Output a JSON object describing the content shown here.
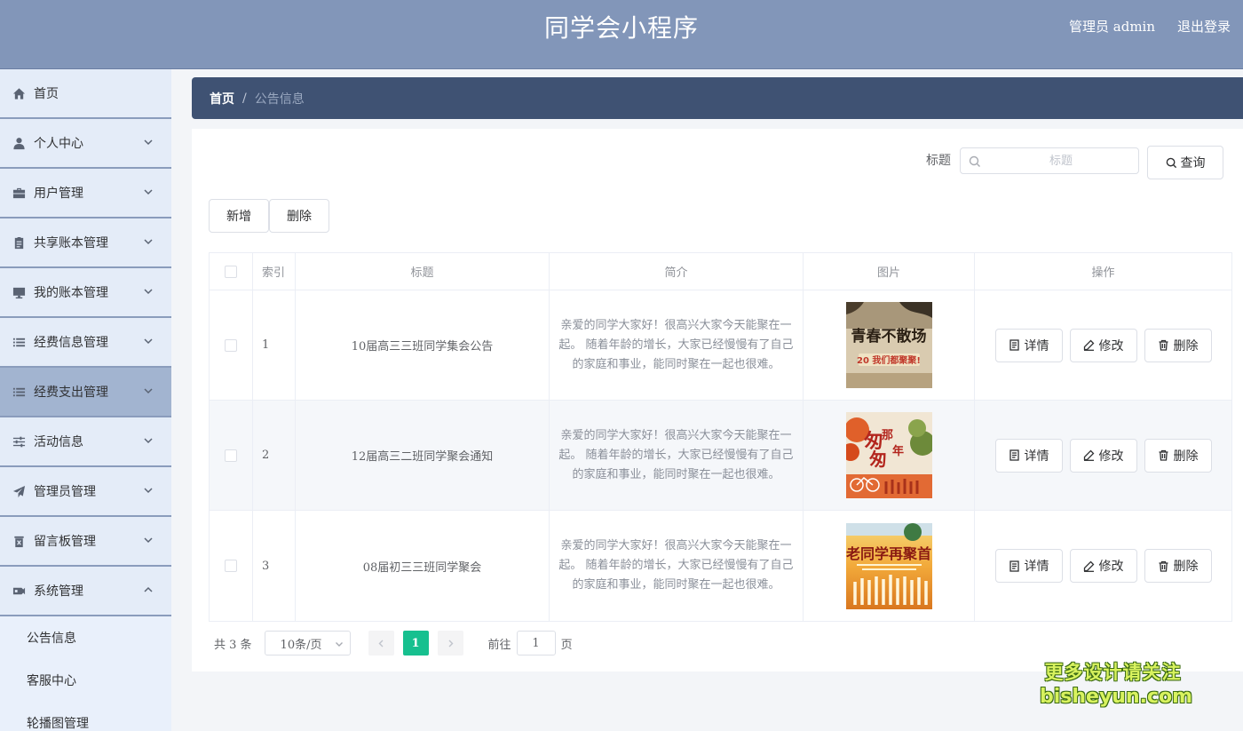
{
  "header": {
    "title": "同学会小程序",
    "admin_label": "管理员 admin",
    "logout_label": "退出登录"
  },
  "sidebar": {
    "items": [
      {
        "label": "首页",
        "icon": "home-icon",
        "has_arrow": false
      },
      {
        "label": "个人中心",
        "icon": "user-icon",
        "has_arrow": true
      },
      {
        "label": "用户管理",
        "icon": "briefcase-icon",
        "has_arrow": true
      },
      {
        "label": "共享账本管理",
        "icon": "clipboard-icon",
        "has_arrow": true
      },
      {
        "label": "我的账本管理",
        "icon": "monitor-icon",
        "has_arrow": true
      },
      {
        "label": "经费信息管理",
        "icon": "list-icon",
        "has_arrow": true
      },
      {
        "label": "经费支出管理",
        "icon": "list-icon",
        "has_arrow": true,
        "active": true
      },
      {
        "label": "活动信息",
        "icon": "sliders-icon",
        "has_arrow": true
      },
      {
        "label": "管理员管理",
        "icon": "send-icon",
        "has_arrow": true
      },
      {
        "label": "留言板管理",
        "icon": "trash-box-icon",
        "has_arrow": true
      },
      {
        "label": "系统管理",
        "icon": "ticket-icon",
        "has_arrow": true,
        "expanded": true
      }
    ],
    "sub_items": [
      {
        "label": "公告信息"
      },
      {
        "label": "客服中心"
      },
      {
        "label": "轮播图管理"
      }
    ]
  },
  "breadcrumb": {
    "home": "首页",
    "separator": "/",
    "current": "公告信息"
  },
  "search": {
    "label": "标题",
    "placeholder": "标题",
    "button_label": "查询"
  },
  "actions": {
    "add_label": "新增",
    "delete_label": "删除"
  },
  "table": {
    "columns": [
      "索引",
      "标题",
      "简介",
      "图片",
      "操作"
    ],
    "rows": [
      {
        "index": "1",
        "title": "10届高三三班同学集会公告",
        "intro": "亲爱的同学大家好！很高兴大家今天能聚在一起。 随着年龄的增长，大家已经慢慢有了自己的家庭和事业，能同时聚在一起也很难。",
        "image": "poster-qingchun"
      },
      {
        "index": "2",
        "title": "12届高三二班同学聚会通知",
        "intro": "亲爱的同学大家好！很高兴大家今天能聚在一起。 随着年龄的增长，大家已经慢慢有了自己的家庭和事业，能同时聚在一起也很难。",
        "image": "poster-congcong"
      },
      {
        "index": "3",
        "title": "08届初三三班同学聚会",
        "intro": "亲爱的同学大家好！很高兴大家今天能聚在一起。 随着年龄的增长，大家已经慢慢有了自己的家庭和事业，能同时聚在一起也很难。",
        "image": "poster-laotongxue"
      }
    ],
    "row_actions": {
      "detail": "详情",
      "edit": "修改",
      "delete": "删除"
    }
  },
  "pagination": {
    "total": "共 3 条",
    "page_size": "10条/页",
    "current_page": "1",
    "goto_prefix": "前往",
    "goto_value": "1",
    "goto_suffix": "页"
  },
  "watermark": {
    "line1": "更多设计请关注",
    "line2": "bisheyun.com"
  },
  "colors": {
    "header_bg": "#8296b9",
    "breadcrumb_bg": "#3f5273",
    "sidebar_bg": "#e4ecf8",
    "active_menu_bg": "#a2b4d0",
    "page_active": "#17c08f"
  }
}
